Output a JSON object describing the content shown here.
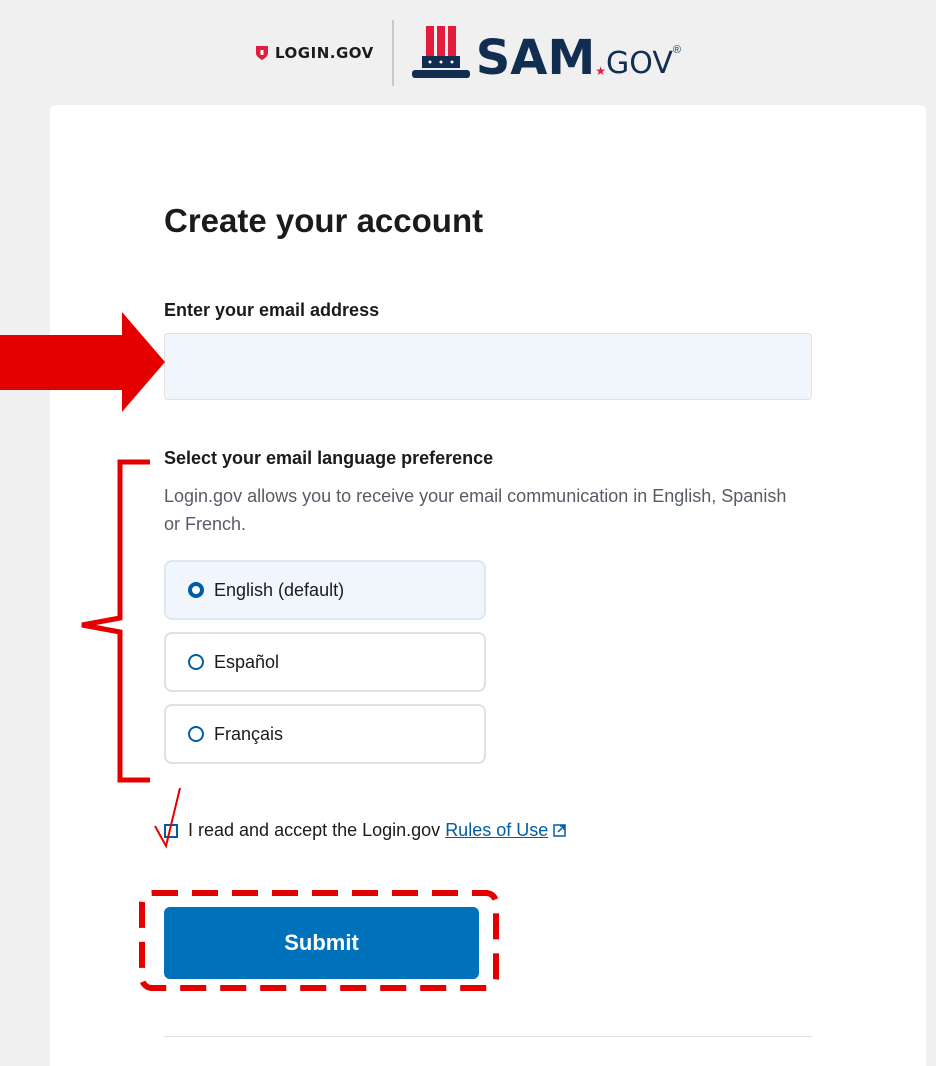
{
  "header": {
    "login_logo_text": "LOGIN.GOV",
    "sam_logo_text": "SAM",
    "sam_logo_suffix": "GOV",
    "sam_reg_mark": "®"
  },
  "form": {
    "title": "Create your account",
    "email_label": "Enter your email address",
    "email_value": "",
    "language": {
      "heading": "Select your email language preference",
      "hint": "Login.gov allows you to receive your email communication in English, Spanish or French.",
      "options": [
        {
          "label": "English (default)",
          "selected": true
        },
        {
          "label": "Español",
          "selected": false
        },
        {
          "label": "Français",
          "selected": false
        }
      ]
    },
    "terms_text": "I read and accept the Login.gov",
    "terms_link": "Rules of Use",
    "submit_label": "Submit"
  },
  "colors": {
    "primary": "#005ea2",
    "button": "#0071bb",
    "annotation": "#e50000"
  }
}
